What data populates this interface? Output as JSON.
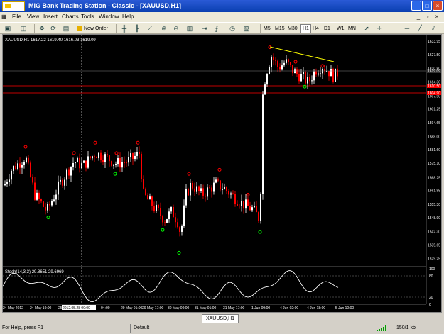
{
  "window": {
    "title": "MIG Bank Trading Station - Classic - [XAUUSD,H1]",
    "buttons": [
      "_",
      "□",
      "×"
    ]
  },
  "menu": {
    "items": [
      "File",
      "View",
      "Insert",
      "Charts",
      "Tools",
      "Window",
      "Help"
    ],
    "mdi_buttons": [
      "_",
      "▫",
      "×"
    ]
  },
  "toolbar": {
    "new_order_label": "New Order",
    "periods": [
      "M5",
      "M15",
      "M30",
      "H1",
      "H4",
      "D1",
      "W1",
      "MN"
    ],
    "active_period": "H1"
  },
  "chart": {
    "header": "XAUUSD,H1  1617.22 1619.40 1616.03 1619.09",
    "indicator_label": "Stoch(14,3,3) 29.8651 29.6969",
    "price_labels": [
      "1633.95",
      "1627.50",
      "1620.80",
      "1619.09",
      "1614.30",
      "1607.50",
      "1601.25",
      "1594.65",
      "1588.00",
      "1581.60",
      "1575.10",
      "1568.25",
      "1561.95",
      "1555.30",
      "1548.90",
      "1542.30",
      "1535.65",
      "1529.25"
    ],
    "current_price": "1619.09",
    "red_level_labels": [
      "1610.50",
      "1604.90"
    ],
    "stoch_labels": [
      "100",
      "80",
      "20",
      "0"
    ],
    "time_labels": [
      "24 May 2012",
      "24 May 19:00",
      "25",
      "2012.05.28 00:00",
      "04:00",
      "29 May 01:00",
      "29 May 17:00",
      "30 May 09:00",
      "31 May 01:00",
      "31 May 17:00",
      "1 Jun 09:00",
      "4 Jun 02:00",
      "4 Jun 18:00",
      "5 Jun 10:00"
    ],
    "highlighted_time": "2012.05.28 00:00",
    "colors": {
      "background": "#000000",
      "bull_candle": "#ffffff",
      "bear_candle": "#ff0000",
      "grid": "#808080",
      "red_marker": "#ff0000",
      "green_marker": "#00ff00",
      "trend_line": "#ffff00",
      "stoch_line": "#ffffff",
      "level_line": "#ff0000"
    }
  },
  "tabs": {
    "items": [
      "XAUUSD,H1"
    ]
  },
  "status": {
    "help": "For Help, press F1",
    "profile": "Default",
    "traffic": "150/1 kb"
  }
}
